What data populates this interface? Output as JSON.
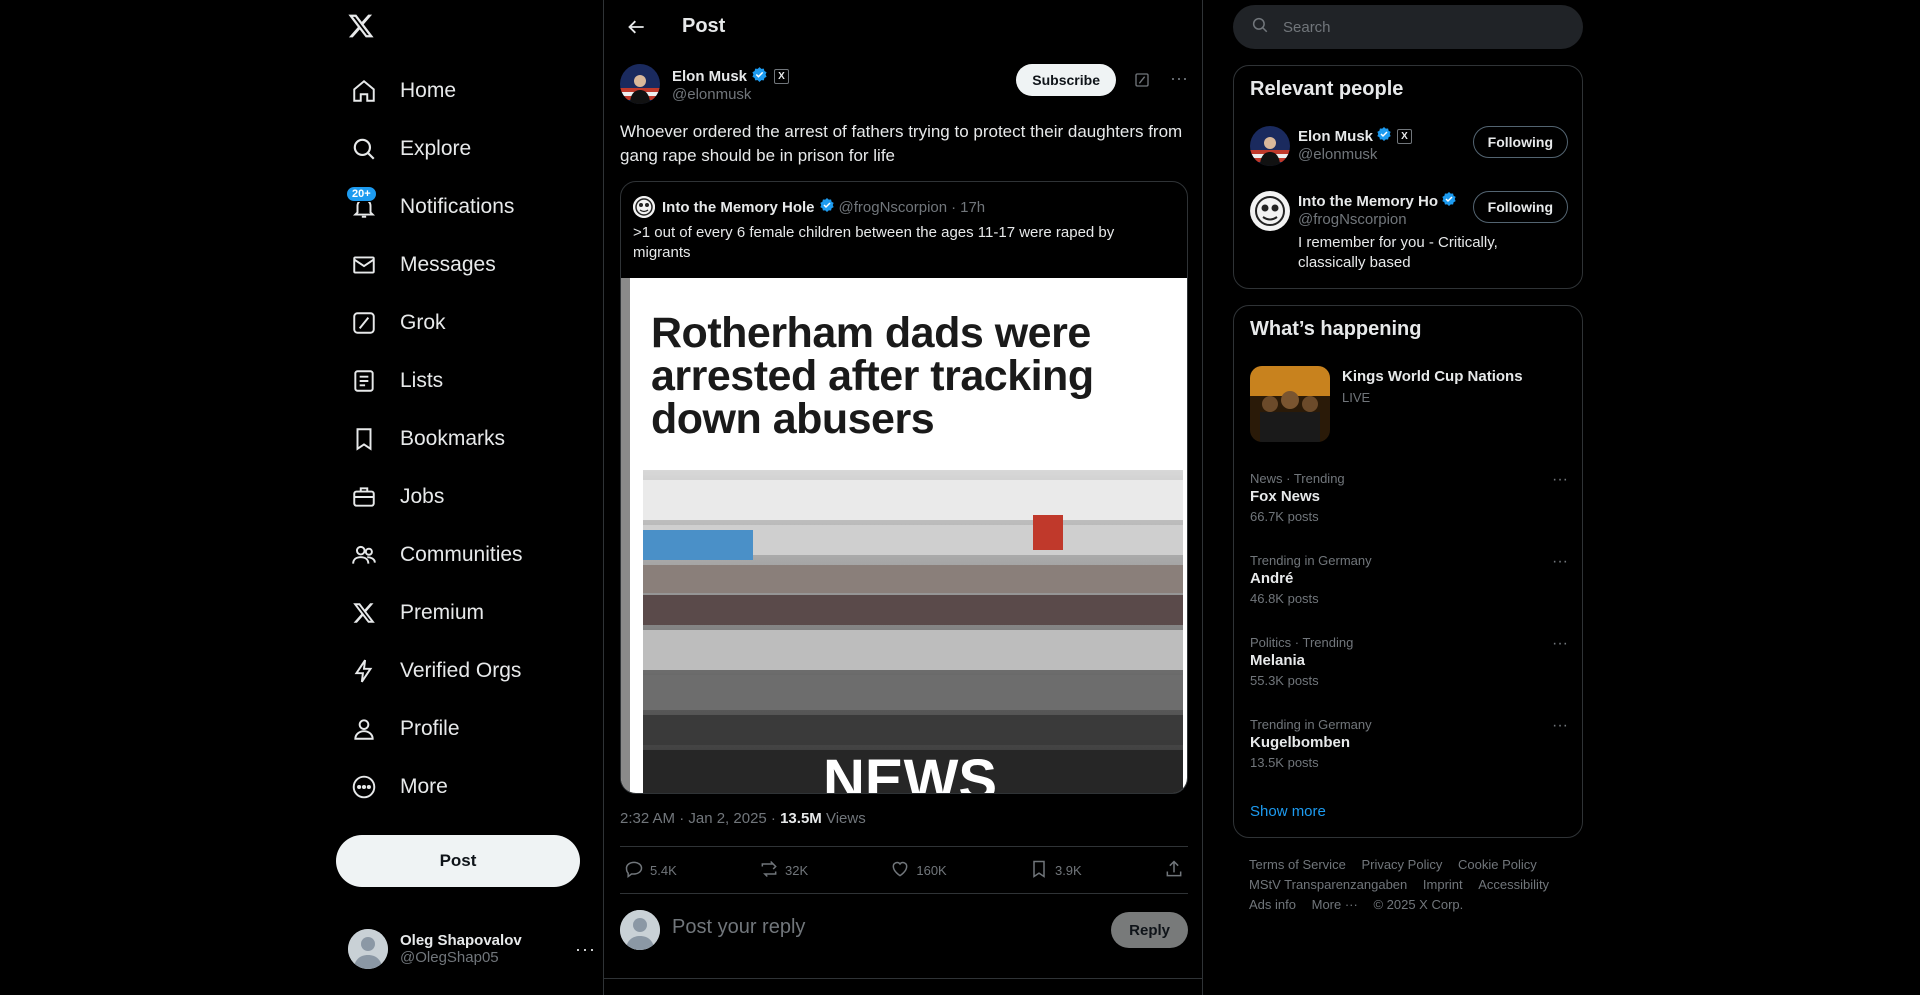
{
  "nav": {
    "items": [
      {
        "label": "Home",
        "icon": "home-icon"
      },
      {
        "label": "Explore",
        "icon": "search-icon"
      },
      {
        "label": "Notifications",
        "icon": "bell-icon",
        "badge": "20+"
      },
      {
        "label": "Messages",
        "icon": "envelope-icon"
      },
      {
        "label": "Grok",
        "icon": "grok-icon"
      },
      {
        "label": "Lists",
        "icon": "list-icon"
      },
      {
        "label": "Bookmarks",
        "icon": "bookmark-icon"
      },
      {
        "label": "Jobs",
        "icon": "briefcase-icon"
      },
      {
        "label": "Communities",
        "icon": "people-icon"
      },
      {
        "label": "Premium",
        "icon": "x-logo-icon"
      },
      {
        "label": "Verified Orgs",
        "icon": "lightning-icon"
      },
      {
        "label": "Profile",
        "icon": "person-icon"
      },
      {
        "label": "More",
        "icon": "more-circle-icon"
      }
    ],
    "post_label": "Post",
    "account": {
      "name": "Oleg Shapovalov",
      "handle": "@OlegShap05"
    }
  },
  "main": {
    "header_title": "Post",
    "author": {
      "name": "Elon Musk",
      "handle": "@elonmusk",
      "badge": "X"
    },
    "subscribe_label": "Subscribe",
    "text": "Whoever ordered the arrest of fathers trying to protect their daughters from gang rape should be in prison for life",
    "quote": {
      "name": "Into the Memory Hole",
      "handle": "@frogNscorpion",
      "time": "17h",
      "sep": "·",
      "text": ">1 out of every 6 female children between the ages 11-17 were raped by migrants",
      "image_headline": "Rotherham dads were arrested after tracking down abusers",
      "image_caption": "NEWS"
    },
    "timestamp": "2:32 AM · Jan 2, 2025 · ",
    "views_count": "13.5M",
    "views_label": " Views",
    "actions": {
      "replies": "5.4K",
      "reposts": "32K",
      "likes": "160K",
      "bookmarks": "3.9K"
    },
    "reply_placeholder": "Post your reply",
    "reply_label": "Reply"
  },
  "right": {
    "search_placeholder": "Search",
    "relevant_title": "Relevant people",
    "people": [
      {
        "name": "Elon Musk",
        "handle": "@elonmusk",
        "button": "Following",
        "bio": ""
      },
      {
        "name": "Into the Memory Ho",
        "handle": "@frogNscorpion",
        "button": "Following",
        "bio": "I remember for you - Critically, classically based"
      }
    ],
    "happening_title": "What’s happening",
    "live_event": {
      "title": "Kings World Cup Nations",
      "status": "LIVE"
    },
    "trends": [
      {
        "meta": "News · Trending",
        "title": "Fox News",
        "count": "66.7K posts"
      },
      {
        "meta": "Trending in Germany",
        "title": "André",
        "count": "46.8K posts"
      },
      {
        "meta": "Politics · Trending",
        "title": "Melania",
        "count": "55.3K posts"
      },
      {
        "meta": "Trending in Germany",
        "title": "Kugelbomben",
        "count": "13.5K posts"
      }
    ],
    "show_more": "Show more",
    "footer": [
      "Terms of Service",
      "Privacy Policy",
      "Cookie Policy",
      "MStV Transparenzangaben",
      "Imprint",
      "Accessibility",
      "Ads info",
      "More ···",
      "© 2025 X Corp."
    ]
  },
  "colors": {
    "accent": "#1d9bf0",
    "background": "#000000",
    "border": "#2f3336",
    "muted": "#71767b"
  }
}
